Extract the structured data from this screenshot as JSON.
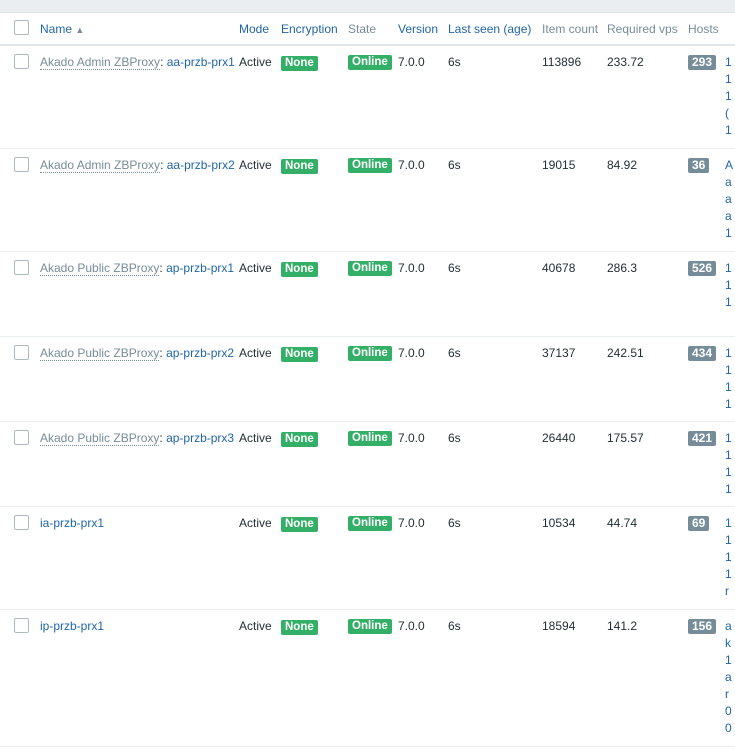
{
  "columns": {
    "name": "Name",
    "mode": "Mode",
    "encryption": "Encryption",
    "state": "State",
    "version": "Version",
    "last_seen": "Last seen (age)",
    "item_count": "Item count",
    "required_vps": "Required vps",
    "hosts": "Hosts"
  },
  "sort_icon": "triangle-up-icon",
  "colors": {
    "link": "#1f65a6",
    "green": "#34af67",
    "badge": "#768d99"
  },
  "rows": [
    {
      "group": "Akado Admin ZBProxy",
      "sep": ": ",
      "name": "aa-przb-prx1",
      "mode": "Active",
      "encryption": "None",
      "state": "Online",
      "version": "7.0.0",
      "last_seen": "6s",
      "item_count": "113896",
      "required_vps": "233.72",
      "hosts_count": "293",
      "hosts": [
        "1",
        "1",
        "1",
        "(",
        "1"
      ]
    },
    {
      "group": "Akado Admin ZBProxy",
      "sep": ": ",
      "name": "aa-przb-prx2",
      "mode": "Active",
      "encryption": "None",
      "state": "Online",
      "version": "7.0.0",
      "last_seen": "6s",
      "item_count": "19015",
      "required_vps": "84.92",
      "hosts_count": "36",
      "hosts": [
        "A",
        "a",
        "a",
        "a",
        "1"
      ]
    },
    {
      "group": "Akado Public ZBProxy",
      "sep": ": ",
      "name": "ap-przb-prx1",
      "mode": "Active",
      "encryption": "None",
      "state": "Online",
      "version": "7.0.0",
      "last_seen": "6s",
      "item_count": "40678",
      "required_vps": "286.3",
      "hosts_count": "526",
      "hosts": [
        "1",
        "1",
        "1"
      ]
    },
    {
      "group": "Akado Public ZBProxy",
      "sep": ": ",
      "name": "ap-przb-prx2",
      "mode": "Active",
      "encryption": "None",
      "state": "Online",
      "version": "7.0.0",
      "last_seen": "6s",
      "item_count": "37137",
      "required_vps": "242.51",
      "hosts_count": "434",
      "hosts": [
        "1",
        "1",
        "1",
        "1"
      ]
    },
    {
      "group": "Akado Public ZBProxy",
      "sep": ": ",
      "name": "ap-przb-prx3",
      "mode": "Active",
      "encryption": "None",
      "state": "Online",
      "version": "7.0.0",
      "last_seen": "6s",
      "item_count": "26440",
      "required_vps": "175.57",
      "hosts_count": "421",
      "hosts": [
        "1",
        "1",
        "1",
        "1"
      ]
    },
    {
      "group": "",
      "sep": "",
      "name": "ia-przb-prx1",
      "mode": "Active",
      "encryption": "None",
      "state": "Online",
      "version": "7.0.0",
      "last_seen": "6s",
      "item_count": "10534",
      "required_vps": "44.74",
      "hosts_count": "69",
      "hosts": [
        "1",
        "1",
        "1",
        "1",
        "r"
      ]
    },
    {
      "group": "",
      "sep": "",
      "name": "ip-przb-prx1",
      "mode": "Active",
      "encryption": "None",
      "state": "Online",
      "version": "7.0.0",
      "last_seen": "6s",
      "item_count": "18594",
      "required_vps": "141.2",
      "hosts_count": "156",
      "hosts": [
        "a",
        "k",
        "1",
        "a",
        "r",
        "0",
        "0"
      ]
    }
  ]
}
